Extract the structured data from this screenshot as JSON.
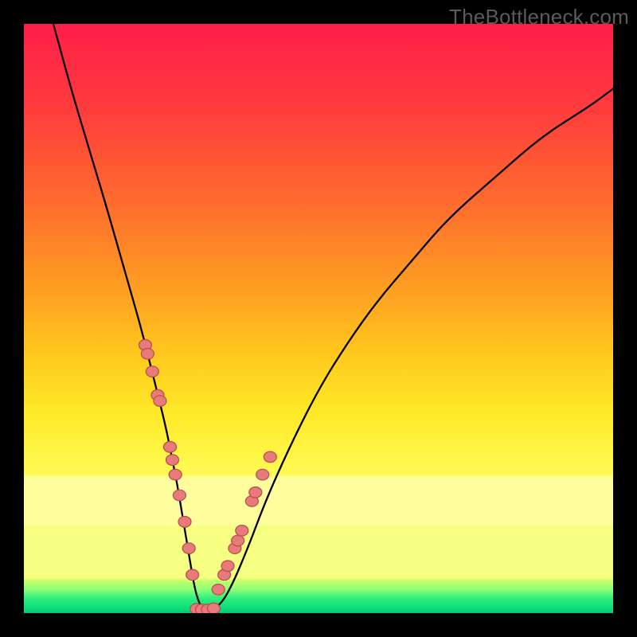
{
  "watermark": "TheBottleneck.com",
  "chart_data": {
    "type": "line",
    "title": "",
    "xlabel": "",
    "ylabel": "",
    "xlim": [
      0,
      100
    ],
    "ylim": [
      0,
      100
    ],
    "gradient_stops": [
      {
        "offset": 0,
        "color": "#ff1e4a"
      },
      {
        "offset": 0.14,
        "color": "#ff3b3d"
      },
      {
        "offset": 0.3,
        "color": "#ff6b2e"
      },
      {
        "offset": 0.44,
        "color": "#ff9b23"
      },
      {
        "offset": 0.56,
        "color": "#ffc81e"
      },
      {
        "offset": 0.66,
        "color": "#ffe927"
      },
      {
        "offset": 0.765,
        "color": "#fffb55"
      },
      {
        "offset": 0.77,
        "color": "#ffff9e"
      },
      {
        "offset": 0.85,
        "color": "#ffff9e"
      },
      {
        "offset": 0.852,
        "color": "#f6ff82"
      },
      {
        "offset": 0.94,
        "color": "#f6ff82"
      },
      {
        "offset": 0.945,
        "color": "#c8ff6a"
      },
      {
        "offset": 0.96,
        "color": "#8cff7a"
      },
      {
        "offset": 0.975,
        "color": "#2fef7e"
      },
      {
        "offset": 0.99,
        "color": "#0ddf7a"
      },
      {
        "offset": 1.0,
        "color": "#05c96e"
      }
    ],
    "curve": {
      "x": [
        5,
        8,
        11,
        14,
        16,
        18,
        20,
        22,
        24,
        25,
        26,
        27,
        28,
        29,
        30,
        31,
        33,
        35,
        38,
        41,
        45,
        50,
        55,
        60,
        66,
        72,
        80,
        88,
        96,
        100
      ],
      "y": [
        100,
        89,
        79,
        69,
        62,
        55,
        48,
        40,
        32,
        27,
        22,
        16,
        10,
        4,
        1,
        0.5,
        1,
        4,
        11,
        19,
        28,
        38,
        46,
        53,
        60,
        67,
        74,
        81,
        86,
        89
      ]
    },
    "markers_left": {
      "x": [
        20.6,
        21.0,
        21.8,
        22.7,
        23.1,
        24.8,
        25.2,
        25.7,
        26.4,
        27.3,
        28.0,
        28.6
      ],
      "y": [
        45.5,
        44.0,
        41.0,
        37.0,
        36.0,
        28.2,
        26.0,
        23.5,
        20.0,
        15.5,
        11.0,
        6.5
      ]
    },
    "markers_right": {
      "x": [
        33.0,
        34.0,
        34.6,
        35.8,
        36.3,
        37.0,
        38.7,
        39.3,
        40.5,
        41.8
      ],
      "y": [
        4.0,
        6.5,
        8.0,
        11.0,
        12.3,
        14.0,
        19.0,
        20.5,
        23.5,
        26.5
      ]
    },
    "markers_bottom": {
      "x": [
        29.3,
        30.2,
        31.2,
        32.2
      ],
      "y": [
        0.7,
        0.6,
        0.6,
        0.8
      ]
    },
    "marker_style": {
      "radius_px": 8,
      "fill": "#e77b7b",
      "stroke": "#ba4a4a",
      "stroke_width": 1.2
    },
    "curve_style": {
      "stroke": "#000000",
      "stroke_width": 2.3
    }
  }
}
